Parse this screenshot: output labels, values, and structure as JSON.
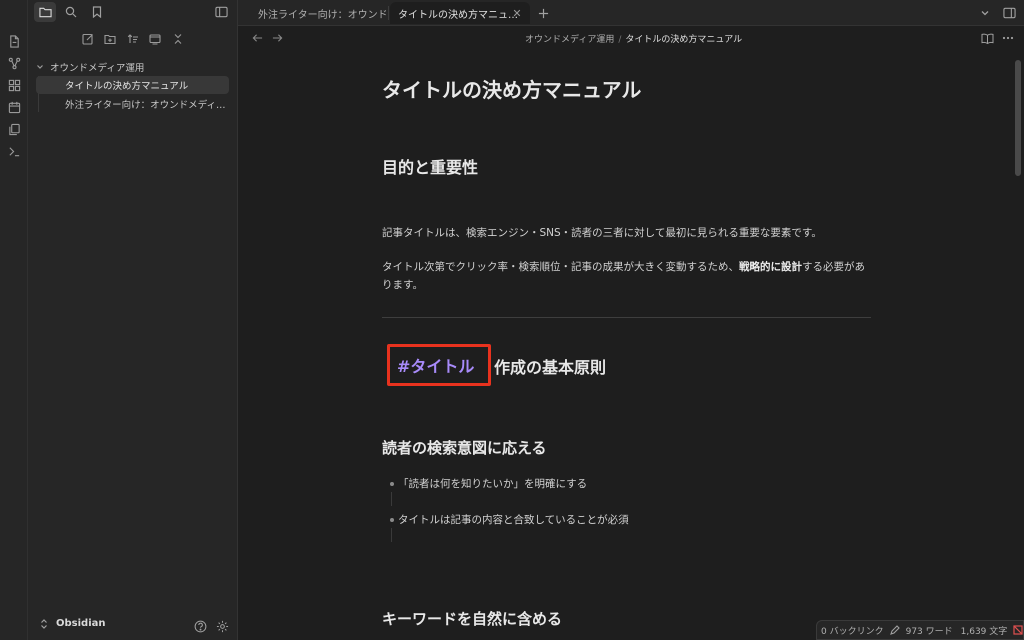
{
  "sidebar": {
    "folder_name": "オウンドメディア運用",
    "files": [
      {
        "label": "タイトルの決め方マニュアル",
        "active": true
      },
      {
        "label": "外注ライター向け：オウンドメディ…",
        "active": false
      }
    ],
    "vault_name": "Obsidian"
  },
  "tabs": [
    {
      "label": "外注ライター向け：オウンド…",
      "active": false
    },
    {
      "label": "タイトルの決め方マニュ…",
      "active": true
    }
  ],
  "breadcrumb": {
    "folder": "オウンドメディア運用",
    "separator": "/",
    "current": "タイトルの決め方マニュアル"
  },
  "document": {
    "title": "タイトルの決め方マニュアル",
    "section1_heading": "目的と重要性",
    "para1": "記事タイトルは、検索エンジン・SNS・読者の三者に対して最初に見られる重要な要素です。",
    "para2_before": "タイトル次第でクリック率・検索順位・記事の成果が大きく変動するため、",
    "para2_bold": "戦略的に設計",
    "para2_after": "する必要があります。",
    "section2_tag": "#タイトル",
    "section2_heading_rest": " 作成の基本原則",
    "sub1_heading": "読者の検索意図に応える",
    "sub1_items": [
      "「読者は何を知りたいか」を明確にする",
      "タイトルは記事の内容と合致していることが必須"
    ],
    "sub2_heading": "キーワードを自然に含める"
  },
  "statusbar": {
    "backlinks": "0 バックリンク",
    "words": "973 ワード",
    "chars": "1,639 文字"
  },
  "colors": {
    "background": "#1e1e1e",
    "sidebar": "#262626",
    "tag": "#a88bfa",
    "highlight_box": "#e8321e"
  }
}
